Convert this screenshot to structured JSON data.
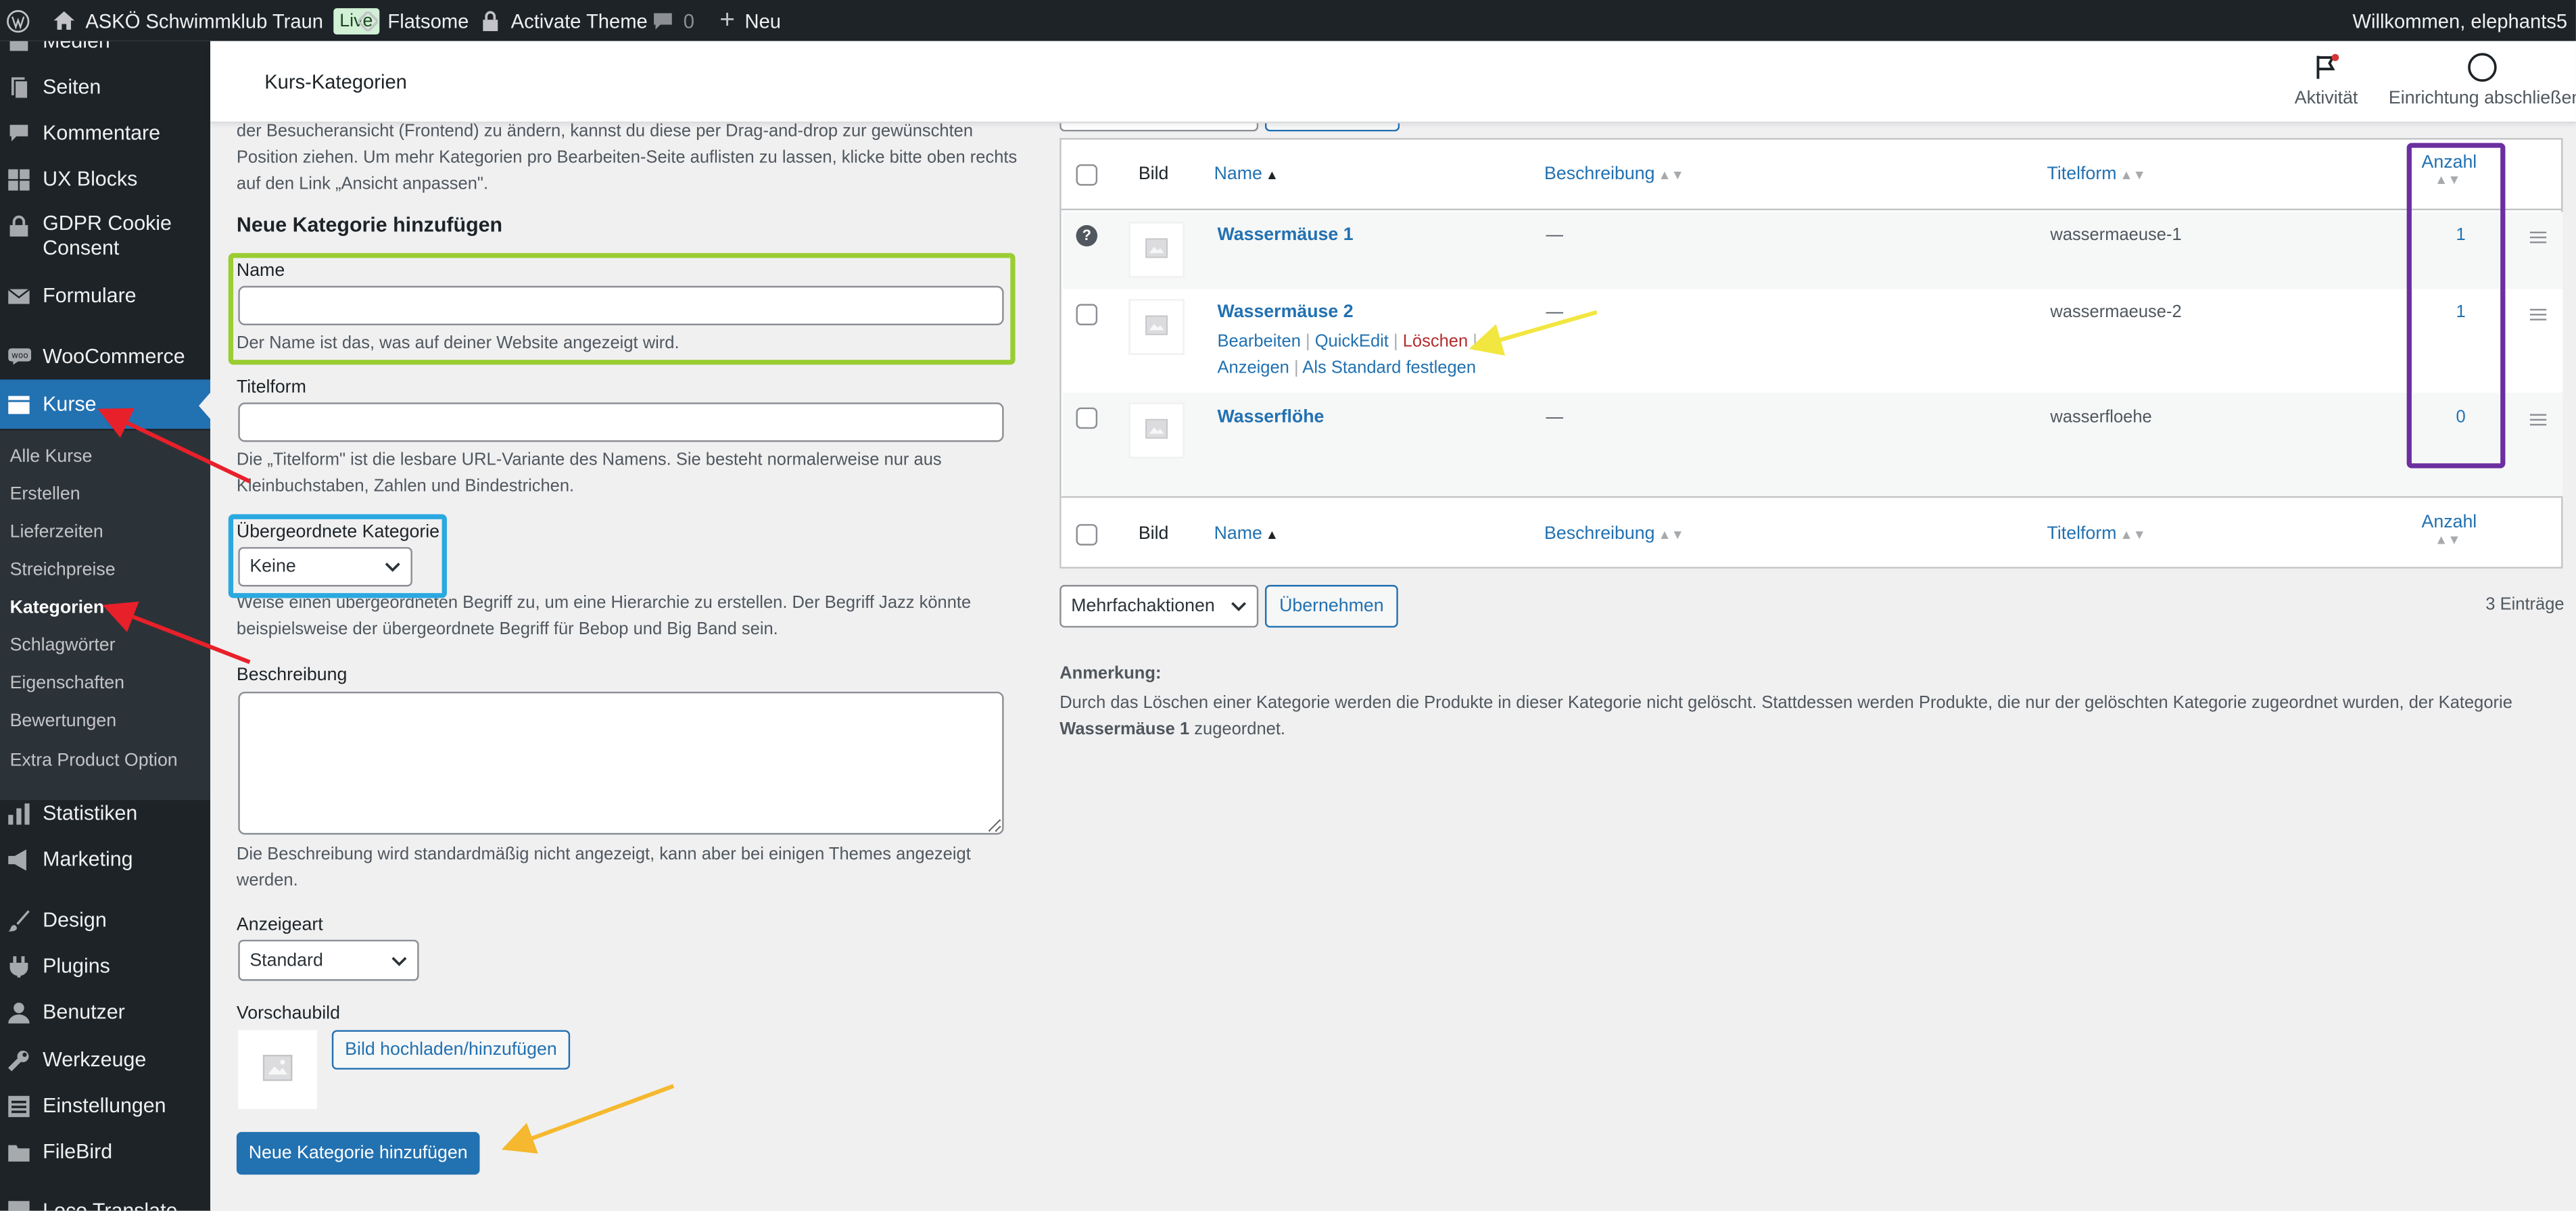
{
  "admin_bar": {
    "site_name": "ASKÖ Schwimmklub Traun",
    "live_badge": "Live",
    "theme": "Flatsome",
    "activate_theme": "Activate Theme",
    "comments_count": "0",
    "new_label": "Neu",
    "greeting": "Willkommen, elephants5"
  },
  "sidebar": {
    "items_top": [
      {
        "label": "Medien",
        "icon": "media-icon"
      },
      {
        "label": "Seiten",
        "icon": "pages-icon"
      },
      {
        "label": "Kommentare",
        "icon": "comments-icon"
      },
      {
        "label": "UX Blocks",
        "icon": "ux-blocks-icon"
      },
      {
        "label": "GDPR Cookie Consent",
        "icon": "lock-icon"
      },
      {
        "label": "Formulare",
        "icon": "mail-icon"
      },
      {
        "label": "WooCommerce",
        "icon": "woocommerce-icon"
      },
      {
        "label": "Kurse",
        "icon": "archive-icon"
      }
    ],
    "submenu": [
      {
        "label": "Alle Kurse"
      },
      {
        "label": "Erstellen"
      },
      {
        "label": "Lieferzeiten"
      },
      {
        "label": "Streichpreise"
      },
      {
        "label": "Kategorien"
      },
      {
        "label": "Schlagwörter"
      },
      {
        "label": "Eigenschaften"
      },
      {
        "label": "Bewertungen"
      },
      {
        "label": "Extra Product Option"
      }
    ],
    "items_bottom": [
      {
        "label": "Statistiken",
        "icon": "chart-icon"
      },
      {
        "label": "Marketing",
        "icon": "megaphone-icon"
      },
      {
        "label": "Design",
        "icon": "brush-icon"
      },
      {
        "label": "Plugins",
        "icon": "plugin-icon"
      },
      {
        "label": "Benutzer",
        "icon": "user-icon"
      },
      {
        "label": "Werkzeuge",
        "icon": "wrench-icon"
      },
      {
        "label": "Einstellungen",
        "icon": "settings-icon"
      },
      {
        "label": "FileBird",
        "icon": "folder-icon"
      },
      {
        "label": "Loco Translate",
        "icon": "translate-icon"
      }
    ]
  },
  "header": {
    "title": "Kurs-Kategorien",
    "activity_label": "Aktivität",
    "setup_label": "Einrichtung abschließen"
  },
  "form": {
    "intro_lines": [
      "der Besucheransicht (Frontend) zu ändern, kannst du diese per Drag-and-drop zur gewünschten",
      "Position ziehen. Um mehr Kategorien pro Bearbeiten-Seite auflisten zu lassen, klicke bitte oben rechts",
      "auf den Link „Ansicht anpassen\"."
    ],
    "heading": "Neue Kategorie hinzufügen",
    "name_label": "Name",
    "name_value": "",
    "name_help": "Der Name ist das, was auf deiner Website angezeigt wird.",
    "slug_label": "Titelform",
    "slug_value": "",
    "slug_help_lines": [
      "Die „Titelform\" ist die lesbare URL-Variante des Namens. Sie besteht normalerweise nur aus",
      "Kleinbuchstaben, Zahlen und Bindestrichen."
    ],
    "parent_label": "Übergeordnete Kategorie",
    "parent_value": "Keine",
    "parent_help_lines": [
      "Weise einen übergeordneten Begriff zu, um eine Hierarchie zu erstellen. Der Begriff Jazz könnte",
      "beispielsweise der übergeordnete Begriff für Bebop und Big Band sein."
    ],
    "description_label": "Beschreibung",
    "description_value": "",
    "description_help_lines": [
      "Die Beschreibung wird standardmäßig nicht angezeigt, kann aber bei einigen Themes angezeigt",
      "werden."
    ],
    "display_label": "Anzeigeart",
    "display_value": "Standard",
    "thumbnail_label": "Vorschaubild",
    "upload_button": "Bild hochladen/hinzufügen",
    "submit_button": "Neue Kategorie hinzufügen"
  },
  "table": {
    "columns": {
      "image": "Bild",
      "name": "Name",
      "description": "Beschreibung",
      "slug": "Titelform",
      "count": "Anzahl"
    },
    "rows": [
      {
        "name": "Wassermäuse 1",
        "description": "—",
        "slug": "wassermaeuse-1",
        "count": "1"
      },
      {
        "name": "Wassermäuse 2",
        "description": "—",
        "slug": "wassermaeuse-2",
        "count": "1"
      },
      {
        "name": "Wasserflöhe",
        "description": "—",
        "slug": "wasserfloehe",
        "count": "0"
      }
    ],
    "row_actions": {
      "edit": "Bearbeiten",
      "quick_edit": "QuickEdit",
      "delete": "Löschen",
      "view": "Anzeigen",
      "make_default": "Als Standard festlegen"
    },
    "bulk_actions": "Mehrfachaktionen",
    "apply_button": "Übernehmen",
    "items_count": "3 Einträge"
  },
  "note": {
    "label": "Anmerkung:",
    "text": "Durch das Löschen einer Kategorie werden die Produkte in dieser Kategorie nicht gelöscht. Stattdessen werden Produkte, die nur der gelöschten Kategorie zugeordnet wurden, der Kategorie",
    "category": "Wassermäuse 1",
    "suffix": " zugeordnet."
  },
  "colors": {
    "admin_dark": "#1d2327",
    "accent": "#2271b1",
    "delete": "#b32d2e",
    "highlight_green": "#9acd32",
    "highlight_blue": "#2aa8e0",
    "highlight_purple": "#6b2fa0",
    "arrow_red": "#e8202a",
    "arrow_yellow": "#f2e640",
    "arrow_orange": "#f5b82e"
  }
}
